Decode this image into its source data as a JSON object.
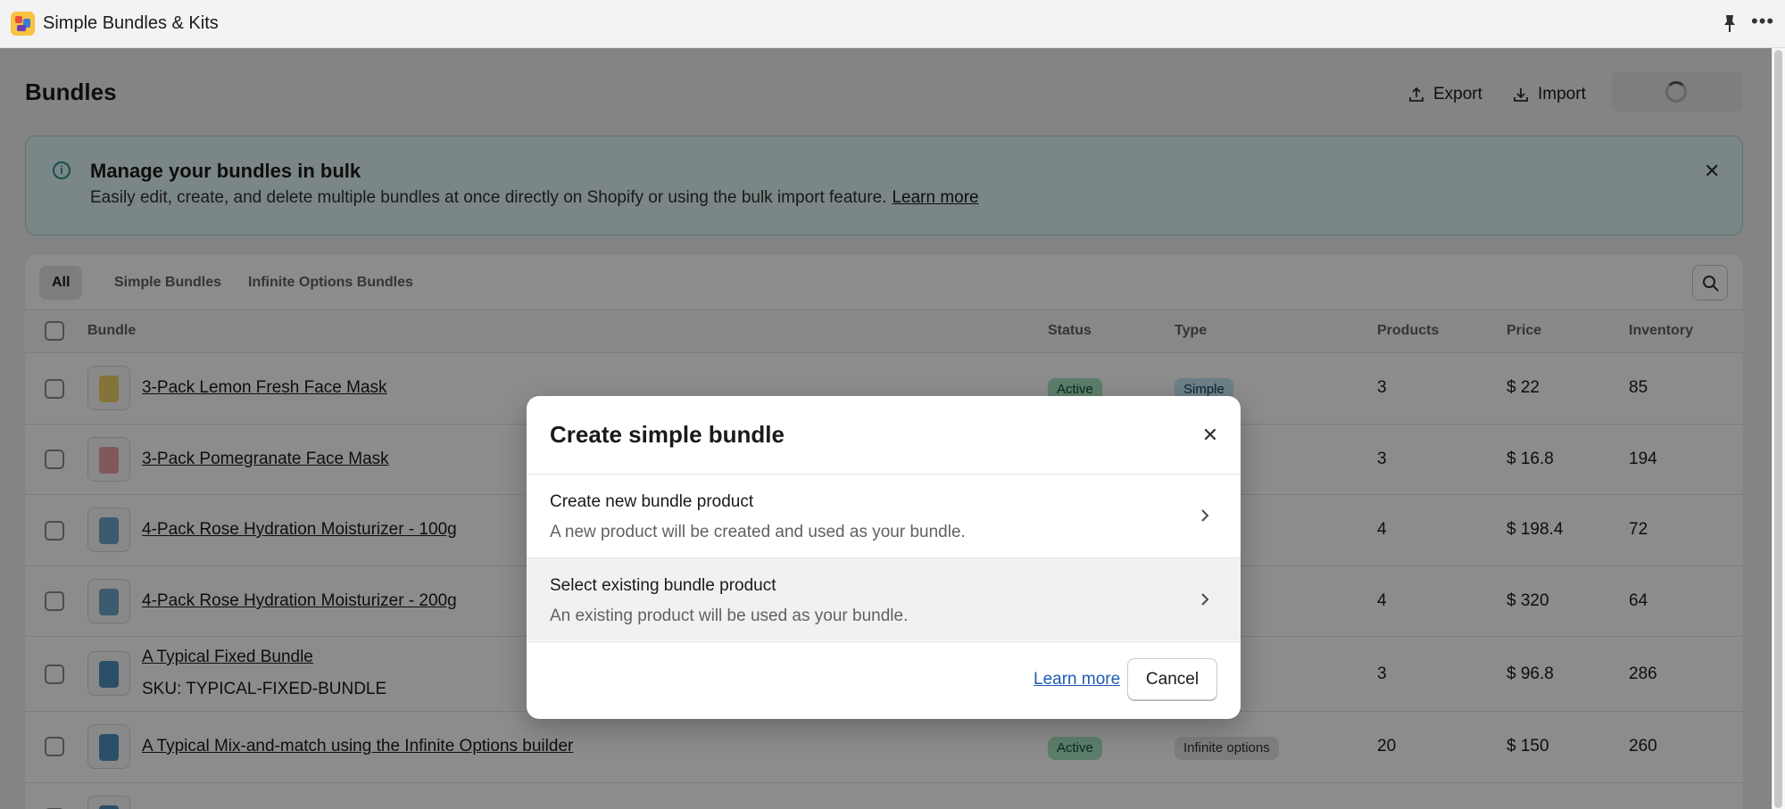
{
  "app": {
    "title": "Simple Bundles & Kits"
  },
  "header": {
    "title": "Bundles",
    "export_label": "Export",
    "import_label": "Import"
  },
  "banner": {
    "title": "Manage your bundles in bulk",
    "text": "Easily edit, create, and delete multiple bundles at once directly on Shopify or using the bulk import feature.",
    "link": "Learn more"
  },
  "tabs": [
    "All",
    "Simple Bundles",
    "Infinite Options Bundles"
  ],
  "table": {
    "columns": [
      "Bundle",
      "Status",
      "Type",
      "Products",
      "Price",
      "Inventory"
    ],
    "rows": [
      {
        "name": "3-Pack Lemon Fresh Face Mask",
        "sku": "",
        "status": "Active",
        "type": "Simple",
        "products": "3",
        "price": "$ 22",
        "inventory": "85"
      },
      {
        "name": "3-Pack Pomegranate Face Mask",
        "sku": "",
        "status": "",
        "type": "",
        "products": "3",
        "price": "$ 16.8",
        "inventory": "194"
      },
      {
        "name": "4-Pack Rose Hydration Moisturizer - 100g",
        "sku": "",
        "status": "",
        "type": "",
        "products": "4",
        "price": "$ 198.4",
        "inventory": "72"
      },
      {
        "name": "4-Pack Rose Hydration Moisturizer - 200g",
        "sku": "",
        "status": "",
        "type": "",
        "products": "4",
        "price": "$ 320",
        "inventory": "64"
      },
      {
        "name": "A Typical Fixed Bundle",
        "sku": "SKU: TYPICAL-FIXED-BUNDLE",
        "status": "",
        "type": "",
        "products": "3",
        "price": "$ 96.8",
        "inventory": "286"
      },
      {
        "name": "A Typical Mix-and-match using the Infinite Options builder",
        "sku": "",
        "status": "Active",
        "type": "Infinite options",
        "products": "20",
        "price": "$ 150",
        "inventory": "260"
      }
    ]
  },
  "modal": {
    "title": "Create simple bundle",
    "options": [
      {
        "title": "Create new bundle product",
        "description": "A new product will be created and used as your bundle."
      },
      {
        "title": "Select existing bundle product",
        "description": "An existing product will be used as your bundle."
      }
    ],
    "learn_more": "Learn more",
    "cancel": "Cancel"
  }
}
